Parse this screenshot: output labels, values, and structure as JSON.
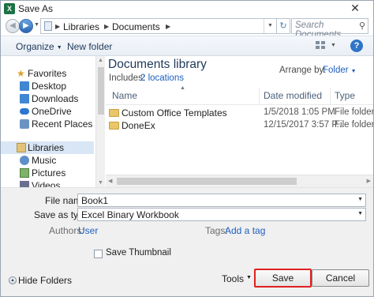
{
  "window": {
    "title": "Save As",
    "app_icon_letter": "X",
    "close_glyph": "✕"
  },
  "address": {
    "crumbs": [
      "Libraries",
      "Documents"
    ],
    "search_placeholder": "Search Documents"
  },
  "toolbar": {
    "organize": "Organize",
    "new_folder": "New folder",
    "help_glyph": "?"
  },
  "nav": {
    "favorites": "Favorites",
    "desktop": "Desktop",
    "downloads": "Downloads",
    "onedrive": "OneDrive",
    "recent": "Recent Places",
    "libraries": "Libraries",
    "music": "Music",
    "pictures": "Pictures",
    "videos": "Videos"
  },
  "library": {
    "title": "Documents library",
    "includes_label": "Includes:",
    "includes_link": "2 locations",
    "arrange_label": "Arrange by:",
    "arrange_value": "Folder"
  },
  "columns": {
    "name": "Name",
    "date": "Date modified",
    "type": "Type"
  },
  "files": [
    {
      "name": "Custom Office Templates",
      "date": "1/5/2018 1:05 PM",
      "type": "File folder"
    },
    {
      "name": "DoneEx",
      "date": "12/15/2017 3:57 P...",
      "type": "File folder"
    }
  ],
  "form": {
    "file_name_label": "File name:",
    "file_name_value": "Book1",
    "save_type_label": "Save as type:",
    "save_type_value": "Excel Binary Workbook",
    "authors_label": "Authors:",
    "authors_value": "User",
    "tags_label": "Tags:",
    "tags_value": "Add a tag",
    "thumbnail_label": "Save Thumbnail"
  },
  "footer": {
    "hide_folders": "Hide Folders",
    "tools": "Tools",
    "save": "Save",
    "cancel": "Cancel"
  },
  "colors": {
    "save_highlight": "#e02020",
    "link": "#1f5fbf",
    "title_blue": "#1e395b"
  }
}
